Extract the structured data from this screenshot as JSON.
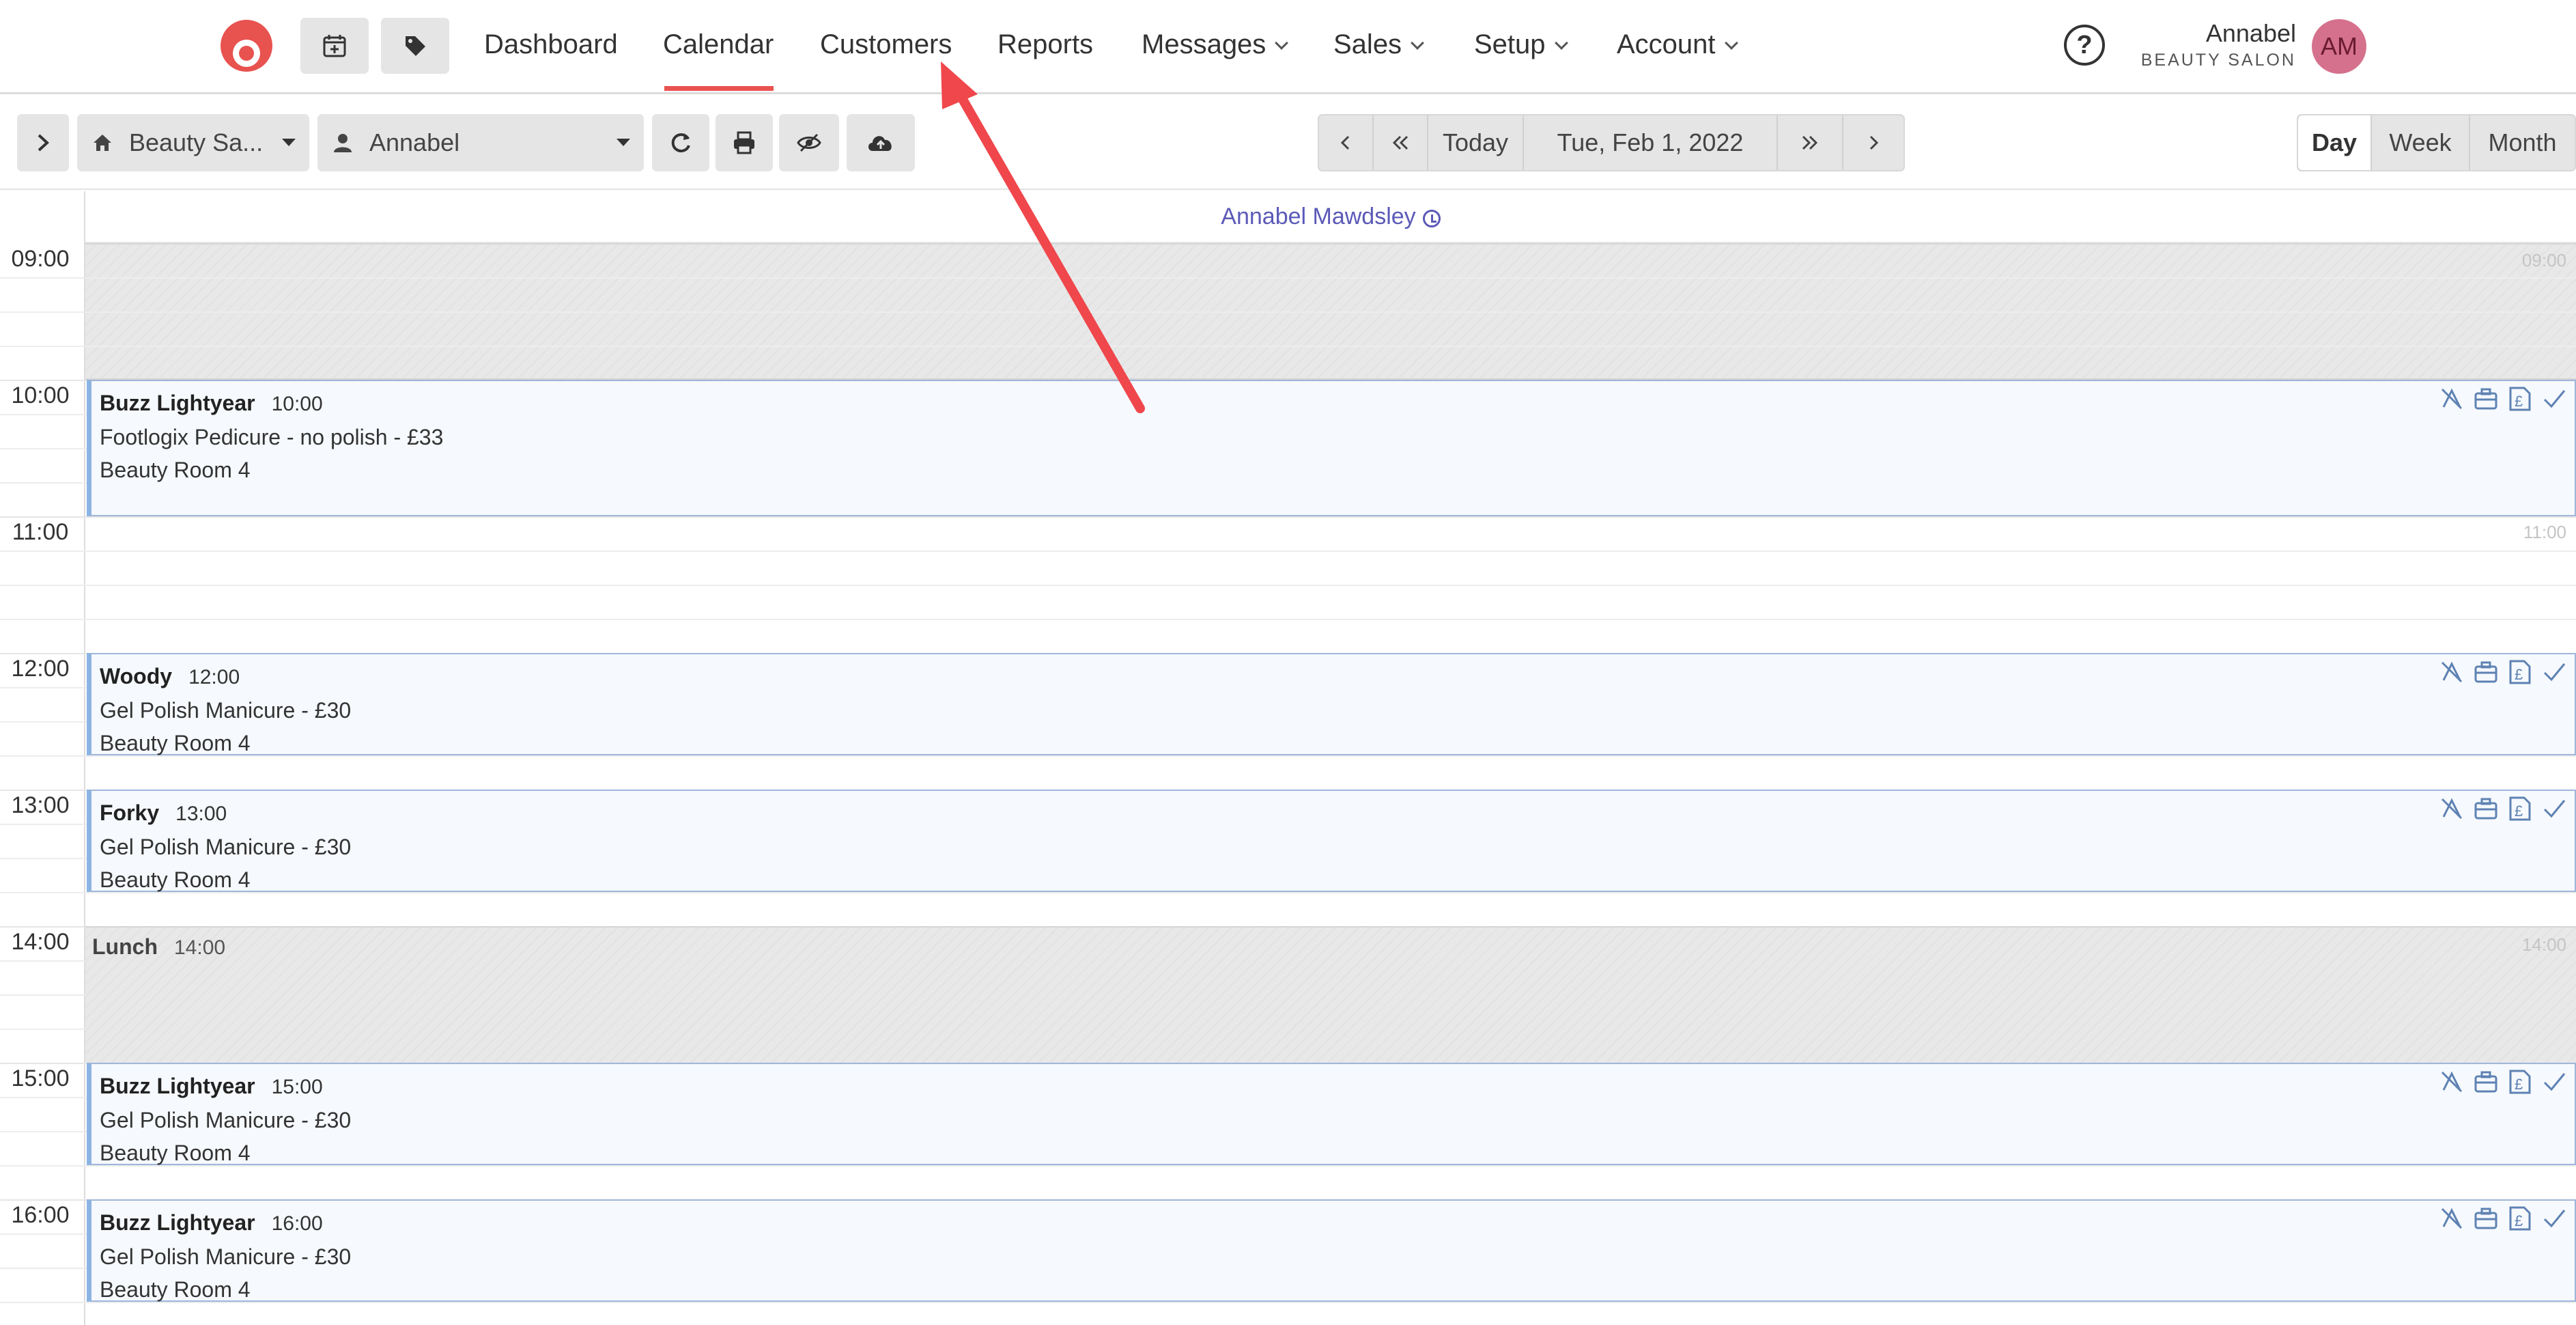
{
  "nav": {
    "items": [
      {
        "label": "Dashboard"
      },
      {
        "label": "Calendar"
      },
      {
        "label": "Customers"
      },
      {
        "label": "Reports"
      },
      {
        "label": "Messages"
      },
      {
        "label": "Sales"
      },
      {
        "label": "Setup"
      },
      {
        "label": "Account"
      }
    ],
    "active": "Calendar",
    "user_name": "Annabel",
    "business": "BEAUTY SALON",
    "avatar_initials": "AM",
    "help_glyph": "?"
  },
  "toolbar": {
    "location": "Beauty Sa...",
    "staff": "Annabel",
    "today_label": "Today",
    "date": "Tue, Feb 1, 2022",
    "views": [
      "Day",
      "Week",
      "Month"
    ],
    "active_view": "Day"
  },
  "calendar": {
    "staff_header": "Annabel Mawdsley",
    "hours": [
      "09:00",
      "10:00",
      "11:00",
      "12:00",
      "13:00",
      "14:00",
      "15:00",
      "16:00"
    ],
    "closed_marker_0900": "09:00",
    "marker_1100": "11:00",
    "marker_1400": "14:00",
    "appointments": [
      {
        "client": "Buzz Lightyear",
        "time": "10:00",
        "service": "Footlogix Pedicure - no polish - £33",
        "room": "Beauty Room 4"
      },
      {
        "client": "Woody",
        "time": "12:00",
        "service": "Gel Polish Manicure - £30",
        "room": "Beauty Room 4"
      },
      {
        "client": "Forky",
        "time": "13:00",
        "service": "Gel Polish Manicure - £30",
        "room": "Beauty Room 4"
      },
      {
        "client": "Buzz Lightyear",
        "time": "15:00",
        "service": "Gel Polish Manicure - £30",
        "room": "Beauty Room 4"
      },
      {
        "client": "Buzz Lightyear",
        "time": "16:00",
        "service": "Gel Polish Manicure - £30",
        "room": "Beauty Room 4"
      }
    ],
    "lunch": {
      "label": "Lunch",
      "time": "14:00"
    }
  },
  "colors": {
    "accent": "#e8524f",
    "staff_link": "#5b59b7",
    "appt_border": "#8bb4e2",
    "annotation_arrow": "#f0474c"
  }
}
